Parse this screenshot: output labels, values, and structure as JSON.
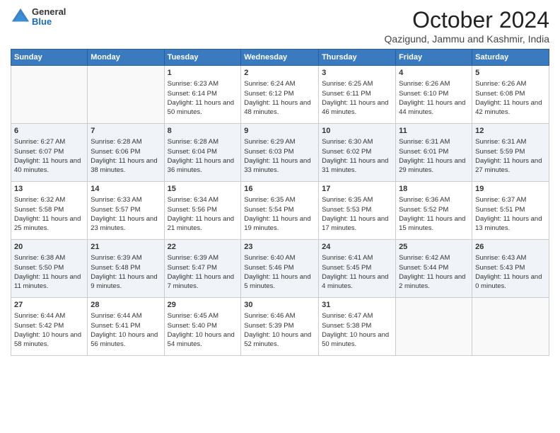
{
  "logo": {
    "general": "General",
    "blue": "Blue"
  },
  "header": {
    "month": "October 2024",
    "location": "Qazigund, Jammu and Kashmir, India"
  },
  "weekdays": [
    "Sunday",
    "Monday",
    "Tuesday",
    "Wednesday",
    "Thursday",
    "Friday",
    "Saturday"
  ],
  "weeks": [
    [
      {
        "day": "",
        "sunrise": "",
        "sunset": "",
        "daylight": ""
      },
      {
        "day": "",
        "sunrise": "",
        "sunset": "",
        "daylight": ""
      },
      {
        "day": "1",
        "sunrise": "Sunrise: 6:23 AM",
        "sunset": "Sunset: 6:14 PM",
        "daylight": "Daylight: 11 hours and 50 minutes."
      },
      {
        "day": "2",
        "sunrise": "Sunrise: 6:24 AM",
        "sunset": "Sunset: 6:12 PM",
        "daylight": "Daylight: 11 hours and 48 minutes."
      },
      {
        "day": "3",
        "sunrise": "Sunrise: 6:25 AM",
        "sunset": "Sunset: 6:11 PM",
        "daylight": "Daylight: 11 hours and 46 minutes."
      },
      {
        "day": "4",
        "sunrise": "Sunrise: 6:26 AM",
        "sunset": "Sunset: 6:10 PM",
        "daylight": "Daylight: 11 hours and 44 minutes."
      },
      {
        "day": "5",
        "sunrise": "Sunrise: 6:26 AM",
        "sunset": "Sunset: 6:08 PM",
        "daylight": "Daylight: 11 hours and 42 minutes."
      }
    ],
    [
      {
        "day": "6",
        "sunrise": "Sunrise: 6:27 AM",
        "sunset": "Sunset: 6:07 PM",
        "daylight": "Daylight: 11 hours and 40 minutes."
      },
      {
        "day": "7",
        "sunrise": "Sunrise: 6:28 AM",
        "sunset": "Sunset: 6:06 PM",
        "daylight": "Daylight: 11 hours and 38 minutes."
      },
      {
        "day": "8",
        "sunrise": "Sunrise: 6:28 AM",
        "sunset": "Sunset: 6:04 PM",
        "daylight": "Daylight: 11 hours and 36 minutes."
      },
      {
        "day": "9",
        "sunrise": "Sunrise: 6:29 AM",
        "sunset": "Sunset: 6:03 PM",
        "daylight": "Daylight: 11 hours and 33 minutes."
      },
      {
        "day": "10",
        "sunrise": "Sunrise: 6:30 AM",
        "sunset": "Sunset: 6:02 PM",
        "daylight": "Daylight: 11 hours and 31 minutes."
      },
      {
        "day": "11",
        "sunrise": "Sunrise: 6:31 AM",
        "sunset": "Sunset: 6:01 PM",
        "daylight": "Daylight: 11 hours and 29 minutes."
      },
      {
        "day": "12",
        "sunrise": "Sunrise: 6:31 AM",
        "sunset": "Sunset: 5:59 PM",
        "daylight": "Daylight: 11 hours and 27 minutes."
      }
    ],
    [
      {
        "day": "13",
        "sunrise": "Sunrise: 6:32 AM",
        "sunset": "Sunset: 5:58 PM",
        "daylight": "Daylight: 11 hours and 25 minutes."
      },
      {
        "day": "14",
        "sunrise": "Sunrise: 6:33 AM",
        "sunset": "Sunset: 5:57 PM",
        "daylight": "Daylight: 11 hours and 23 minutes."
      },
      {
        "day": "15",
        "sunrise": "Sunrise: 6:34 AM",
        "sunset": "Sunset: 5:56 PM",
        "daylight": "Daylight: 11 hours and 21 minutes."
      },
      {
        "day": "16",
        "sunrise": "Sunrise: 6:35 AM",
        "sunset": "Sunset: 5:54 PM",
        "daylight": "Daylight: 11 hours and 19 minutes."
      },
      {
        "day": "17",
        "sunrise": "Sunrise: 6:35 AM",
        "sunset": "Sunset: 5:53 PM",
        "daylight": "Daylight: 11 hours and 17 minutes."
      },
      {
        "day": "18",
        "sunrise": "Sunrise: 6:36 AM",
        "sunset": "Sunset: 5:52 PM",
        "daylight": "Daylight: 11 hours and 15 minutes."
      },
      {
        "day": "19",
        "sunrise": "Sunrise: 6:37 AM",
        "sunset": "Sunset: 5:51 PM",
        "daylight": "Daylight: 11 hours and 13 minutes."
      }
    ],
    [
      {
        "day": "20",
        "sunrise": "Sunrise: 6:38 AM",
        "sunset": "Sunset: 5:50 PM",
        "daylight": "Daylight: 11 hours and 11 minutes."
      },
      {
        "day": "21",
        "sunrise": "Sunrise: 6:39 AM",
        "sunset": "Sunset: 5:48 PM",
        "daylight": "Daylight: 11 hours and 9 minutes."
      },
      {
        "day": "22",
        "sunrise": "Sunrise: 6:39 AM",
        "sunset": "Sunset: 5:47 PM",
        "daylight": "Daylight: 11 hours and 7 minutes."
      },
      {
        "day": "23",
        "sunrise": "Sunrise: 6:40 AM",
        "sunset": "Sunset: 5:46 PM",
        "daylight": "Daylight: 11 hours and 5 minutes."
      },
      {
        "day": "24",
        "sunrise": "Sunrise: 6:41 AM",
        "sunset": "Sunset: 5:45 PM",
        "daylight": "Daylight: 11 hours and 4 minutes."
      },
      {
        "day": "25",
        "sunrise": "Sunrise: 6:42 AM",
        "sunset": "Sunset: 5:44 PM",
        "daylight": "Daylight: 11 hours and 2 minutes."
      },
      {
        "day": "26",
        "sunrise": "Sunrise: 6:43 AM",
        "sunset": "Sunset: 5:43 PM",
        "daylight": "Daylight: 11 hours and 0 minutes."
      }
    ],
    [
      {
        "day": "27",
        "sunrise": "Sunrise: 6:44 AM",
        "sunset": "Sunset: 5:42 PM",
        "daylight": "Daylight: 10 hours and 58 minutes."
      },
      {
        "day": "28",
        "sunrise": "Sunrise: 6:44 AM",
        "sunset": "Sunset: 5:41 PM",
        "daylight": "Daylight: 10 hours and 56 minutes."
      },
      {
        "day": "29",
        "sunrise": "Sunrise: 6:45 AM",
        "sunset": "Sunset: 5:40 PM",
        "daylight": "Daylight: 10 hours and 54 minutes."
      },
      {
        "day": "30",
        "sunrise": "Sunrise: 6:46 AM",
        "sunset": "Sunset: 5:39 PM",
        "daylight": "Daylight: 10 hours and 52 minutes."
      },
      {
        "day": "31",
        "sunrise": "Sunrise: 6:47 AM",
        "sunset": "Sunset: 5:38 PM",
        "daylight": "Daylight: 10 hours and 50 minutes."
      },
      {
        "day": "",
        "sunrise": "",
        "sunset": "",
        "daylight": ""
      },
      {
        "day": "",
        "sunrise": "",
        "sunset": "",
        "daylight": ""
      }
    ]
  ]
}
